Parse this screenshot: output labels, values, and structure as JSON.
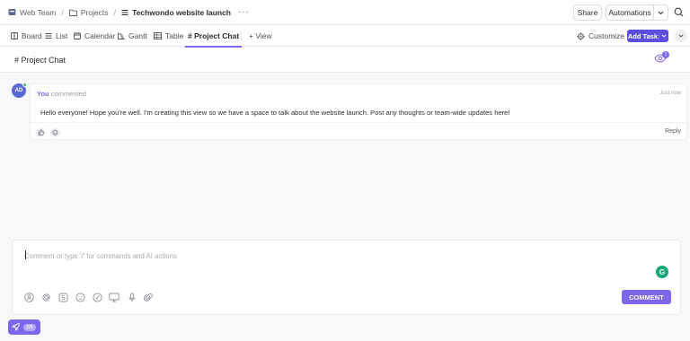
{
  "breadcrumb": {
    "items": [
      {
        "label": "Web Team",
        "icon": "workspace-icon"
      },
      {
        "label": "Projects",
        "icon": "folder-icon"
      },
      {
        "label": "Techwondo website launch",
        "icon": "list-icon"
      }
    ],
    "separator": "/",
    "more": "···"
  },
  "header": {
    "share_label": "Share",
    "automations_label": "Automations"
  },
  "views": {
    "tabs": [
      {
        "label": "Board",
        "icon": "board-icon"
      },
      {
        "label": "List",
        "icon": "list-icon"
      },
      {
        "label": "Calendar",
        "icon": "calendar-icon"
      },
      {
        "label": "Gantt",
        "icon": "gantt-icon"
      },
      {
        "label": "Table",
        "icon": "table-icon"
      },
      {
        "label": "# Project Chat",
        "icon": "hash-icon",
        "active": true
      }
    ],
    "add_view_label": "+ View",
    "customize_label": "Customize",
    "add_task_label": "Add Task"
  },
  "chat": {
    "title": "# Project Chat",
    "watchers_count": "1",
    "comment": {
      "avatar_initials": "AD",
      "author": "You",
      "action": "commented",
      "time": "Just now",
      "text": "Hello everyone! Hope you're well. I'm creating this view so we have a space to talk about the website launch. Post any thoughts or team-wide updates here!",
      "reply_label": "Reply"
    },
    "composer": {
      "placeholder": "Comment or type '/' for commands and AI actions",
      "submit_label": "COMMENT",
      "tools": [
        "assign-icon",
        "mention-icon",
        "emoji-sticker-icon",
        "emoji-icon",
        "slash-command-icon",
        "screen-record-icon",
        "microphone-icon",
        "attach-icon"
      ]
    }
  },
  "launcher": {
    "badge": "2/5"
  },
  "colors": {
    "accent": "#7b68ee",
    "add_task": "#5b4fe0",
    "grammarly": "#15a873",
    "online": "#3dbd6b"
  }
}
